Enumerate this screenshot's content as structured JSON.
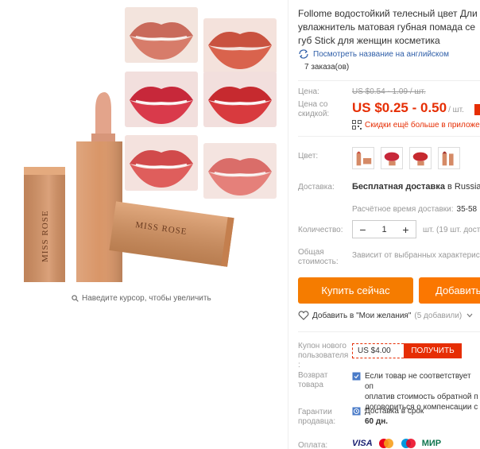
{
  "gallery": {
    "zoom_hint": "Наведите курсор, чтобы увеличить",
    "brand_text": "MISS ROSE"
  },
  "product": {
    "title_lines": [
      "Follome водостойкий телесный цвет Дли",
      "увлажнитель матовая губная помада се",
      "губ Stick для женщин косметика"
    ],
    "translate_link": "Посмотреть название на английском",
    "orders": "7 заказа(ов)"
  },
  "price": {
    "label": "Цена:",
    "old": "US $0.54 - 1.09 / шт.",
    "discount_label_1": "Цена со",
    "discount_label_2": "скидкой:",
    "new": "US $0.25 - 0.50",
    "unit": "/ шт.",
    "promo": "Скидки ещё больше в приложен"
  },
  "color": {
    "label": "Цвет:"
  },
  "shipping": {
    "label": "Доставка:",
    "method_bold": "Бесплатная доставка",
    "method_rest": " в Russian Fe",
    "time_label": "Расчётное время доставки:",
    "time_value": "35-58"
  },
  "quantity": {
    "label": "Количество:",
    "minus": "−",
    "value": "1",
    "plus": "+",
    "note": "шт. (19 шт. доступ"
  },
  "total": {
    "label_1": "Общая",
    "label_2": "стоимость:",
    "note": "Зависит от выбранных характерис"
  },
  "actions": {
    "buy_now": "Купить сейчас",
    "add_to_cart": "Добавить",
    "wishlist": "Добавить в \"Мои желания\"",
    "wishlist_count": "(5 добавили)"
  },
  "coupon": {
    "label_1": "Купон нового",
    "label_2": "пользователя",
    "label_3": ":",
    "amount": "US $4.00",
    "get": "ПОЛУЧИТЬ"
  },
  "return": {
    "label_1": "Возврат",
    "label_2": "товара",
    "line_1": "Если товар не соответствует оп",
    "line_2": "оплатив стоимость обратной п",
    "line_3": "договориться о компенсации с"
  },
  "guarantee": {
    "label_1": "Гарантии",
    "label_2": "продавца:",
    "line_1": "Доставка в срок",
    "line_2": "60 дн."
  },
  "payment": {
    "label": "Оплата:",
    "visa": "VISA",
    "mir": "МИР"
  },
  "colors": {
    "accent": "#e62e04",
    "buy": "#f57c00",
    "link": "#2e5ea8"
  }
}
